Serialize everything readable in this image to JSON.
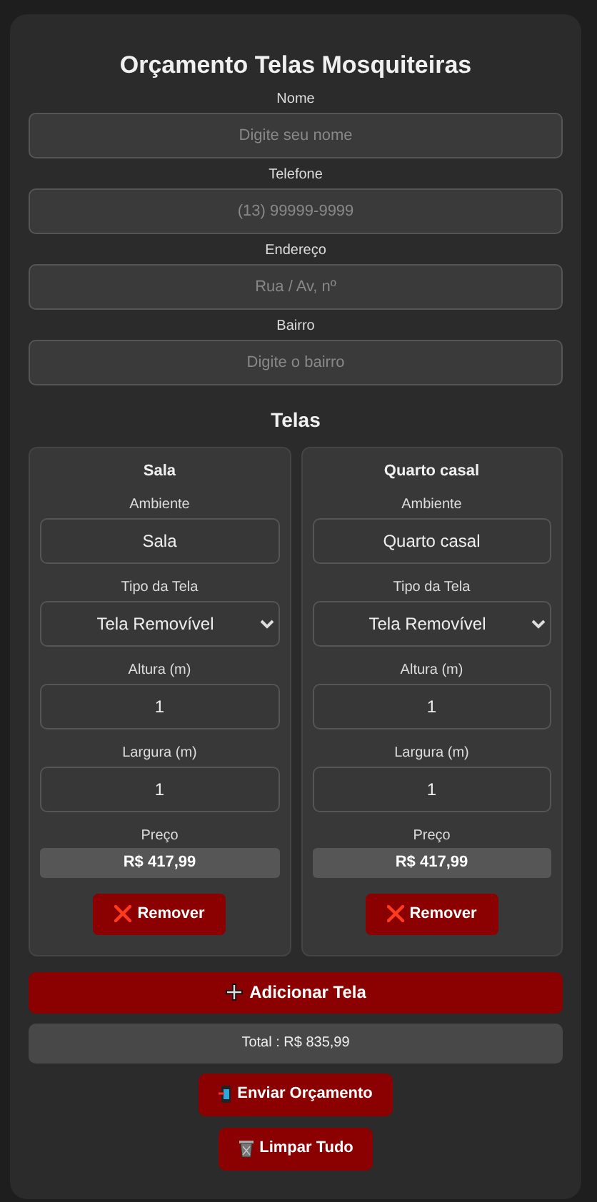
{
  "title": "Orçamento Telas Mosquiteiras",
  "fields": [
    {
      "label": "Nome",
      "placeholder": "Digite seu nome"
    },
    {
      "label": "Telefone",
      "placeholder": "(13) 99999-9999"
    },
    {
      "label": "Endereço",
      "placeholder": "Rua / Av, nº"
    },
    {
      "label": "Bairro",
      "placeholder": "Digite o bairro"
    }
  ],
  "screens_heading": "Telas",
  "screens": [
    {
      "title": "Sala",
      "ambiente_label": "Ambiente",
      "ambiente": "Sala",
      "tipo_label": "Tipo da Tela",
      "tipo": "Tela Removível",
      "altura_label": "Altura (m)",
      "altura": "1",
      "largura_label": "Largura (m)",
      "largura": "1",
      "preco_label": "Preço",
      "preco": "R$ 417,99",
      "remove": "Remover"
    },
    {
      "title": "Quarto casal",
      "ambiente_label": "Ambiente",
      "ambiente": "Quarto casal",
      "tipo_label": "Tipo da Tela",
      "tipo": "Tela Removível",
      "altura_label": "Altura (m)",
      "altura": "1",
      "largura_label": "Largura (m)",
      "largura": "1",
      "preco_label": "Preço",
      "preco": "R$ 417,99",
      "remove": "Remover"
    }
  ],
  "add_button": "Adicionar Tela",
  "total": "Total : R$ 835,99",
  "send_button": "Enviar Orçamento",
  "clear_button": "Limpar Tudo"
}
